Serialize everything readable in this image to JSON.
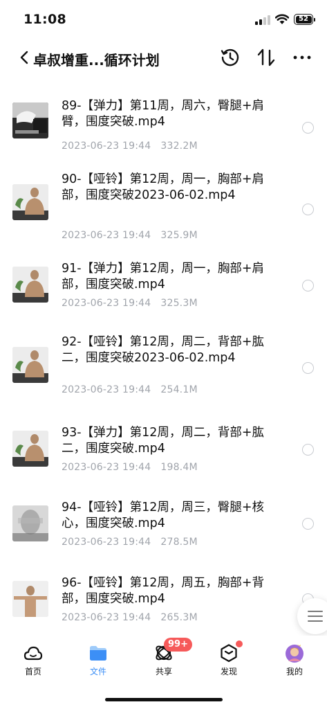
{
  "status_bar": {
    "time": "11:08",
    "battery": "52"
  },
  "nav": {
    "title": "卓叔增重...循环计划"
  },
  "files": [
    {
      "name": "89-【弹力】第11周，周六，臀腿+肩臂，围度突破.mp4",
      "date": "2023-06-23 19:44",
      "size": "332.2M",
      "thumb": "gym-dark"
    },
    {
      "name": "90-【哑铃】第12周，周一，胸部+肩部，围度突破2023-06-02.mp4",
      "date": "2023-06-23 19:44",
      "size": "325.9M",
      "thumb": "man-back-plant"
    },
    {
      "name": "91-【弹力】第12周，周一，胸部+肩部，围度突破.mp4",
      "date": "2023-06-23 19:44",
      "size": "325.3M",
      "thumb": "man-back-plant"
    },
    {
      "name": "92-【哑铃】第12周，周二，背部+肱二，围度突破2023-06-02.mp4",
      "date": "2023-06-23 19:44",
      "size": "254.1M",
      "thumb": "man-back-plant"
    },
    {
      "name": "93-【弹力】第12周，周二，背部+肱二，围度突破.mp4",
      "date": "2023-06-23 19:44",
      "size": "198.4M",
      "thumb": "man-back-plant"
    },
    {
      "name": "94-【哑铃】第12周，周三，臀腿+核心，围度突破.mp4",
      "date": "2023-06-23 19:44",
      "size": "278.5M",
      "thumb": "blurred-gym"
    },
    {
      "name": "96-【哑铃】第12周，周五，胸部+背部，围度突破.mp4",
      "date": "2023-06-23 19:44",
      "size": "265.3M",
      "thumb": "man-arms-out"
    }
  ],
  "tabs": [
    {
      "label": "首页",
      "icon": "cloud-home-icon"
    },
    {
      "label": "文件",
      "icon": "folder-icon",
      "active": true
    },
    {
      "label": "共享",
      "icon": "share-orbit-icon",
      "badge": "99+"
    },
    {
      "label": "发现",
      "icon": "discover-cube-icon",
      "dot": true
    },
    {
      "label": "我的",
      "icon": "avatar-icon"
    }
  ],
  "colors": {
    "accent": "#3c8ff6",
    "badge": "#f65a5a",
    "meta_text": "#a0a4ab"
  }
}
